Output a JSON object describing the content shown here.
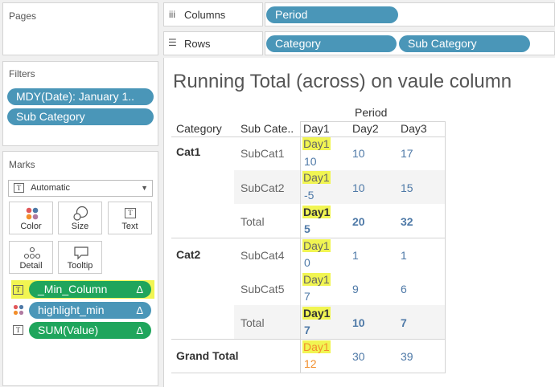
{
  "pages": {
    "title": "Pages"
  },
  "shelves": {
    "columns_label": "Columns",
    "rows_label": "Rows",
    "columns_pills": [
      "Period"
    ],
    "rows_pills": [
      "Category",
      "Sub Category"
    ]
  },
  "filters": {
    "title": "Filters",
    "items": [
      "MDY(Date): January 1..",
      "Sub Category"
    ]
  },
  "marks": {
    "title": "Marks",
    "type_value": "Automatic",
    "buttons": [
      "Color",
      "Size",
      "Text",
      "Detail",
      "Tooltip"
    ],
    "fields": [
      {
        "name": "_Min_Column",
        "delta": "Δ"
      },
      {
        "name": "highlight_min",
        "delta": "Δ"
      },
      {
        "name": "SUM(Value)",
        "delta": "Δ"
      }
    ]
  },
  "view": {
    "title": "Running Total (across) on vaule column",
    "period_header": "Period",
    "headers": [
      "Category",
      "Sub Cate..",
      "Day1",
      "Day2",
      "Day3"
    ],
    "rows": [
      {
        "category": "Cat1",
        "sub": "SubCat1",
        "d1_label": "Day1",
        "d1": "10",
        "d2": "10",
        "d3": "17"
      },
      {
        "category": "",
        "sub": "SubCat2",
        "d1_label": "Day1",
        "d1": "-5",
        "d2": "10",
        "d3": "15"
      },
      {
        "category": "",
        "sub": "Total",
        "d1_label": "Day1",
        "d1": "5",
        "d2": "20",
        "d3": "32"
      },
      {
        "category": "Cat2",
        "sub": "SubCat4",
        "d1_label": "Day1",
        "d1": "0",
        "d2": "1",
        "d3": "1"
      },
      {
        "category": "",
        "sub": "SubCat5",
        "d1_label": "Day1",
        "d1": "7",
        "d2": "9",
        "d3": "6"
      },
      {
        "category": "",
        "sub": "Total",
        "d1_label": "Day1",
        "d1": "7",
        "d2": "10",
        "d3": "7"
      }
    ],
    "grand_total": {
      "label": "Grand Total",
      "d1_label": "Day1",
      "d1": "12",
      "d2": "30",
      "d3": "39"
    }
  }
}
